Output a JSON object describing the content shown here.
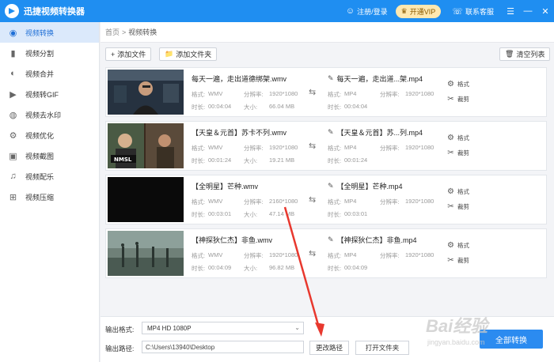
{
  "app": {
    "title": "迅捷视频转换器",
    "login": "注册/登录",
    "vip": "开通VIP",
    "service": "联系客服"
  },
  "sidebar": {
    "items": [
      {
        "label": "视频转换",
        "icon": "video-convert-icon"
      },
      {
        "label": "视频分割",
        "icon": "split-icon"
      },
      {
        "label": "视频合并",
        "icon": "merge-icon"
      },
      {
        "label": "视频转GIF",
        "icon": "gif-icon"
      },
      {
        "label": "视频去水印",
        "icon": "watermark-remove-icon"
      },
      {
        "label": "视频优化",
        "icon": "optimize-icon"
      },
      {
        "label": "视频截图",
        "icon": "screenshot-icon"
      },
      {
        "label": "视频配乐",
        "icon": "music-icon"
      },
      {
        "label": "视频压缩",
        "icon": "compress-icon"
      }
    ]
  },
  "breadcrumb": {
    "home": "首页",
    "sep": ">",
    "current": "视频转换"
  },
  "toolbar": {
    "add_file": "添加文件",
    "add_folder": "添加文件夹",
    "clear_list": "清空列表"
  },
  "labels": {
    "format": "格式:",
    "resolution": "分辨率:",
    "duration": "时长:",
    "size": "大小:",
    "act_format": "格式",
    "act_cut": "裁剪"
  },
  "files": [
    {
      "src_name": "每天一遍，走出道德绑架.wmv",
      "src_format": "WMV",
      "src_resolution": "1920*1080",
      "src_duration": "00:04:04",
      "src_size": "66.04 MB",
      "dst_name": "每天一遍，走出道...架.mp4",
      "dst_format": "MP4",
      "dst_resolution": "1920*1080",
      "dst_duration": "00:04:04"
    },
    {
      "src_name": "【天皇＆元首】苏卡不列.wmv",
      "src_format": "WMV",
      "src_resolution": "1920*1080",
      "src_duration": "00:01:24",
      "src_size": "19.21 MB",
      "dst_name": "【天皇＆元首】苏...列.mp4",
      "dst_format": "MP4",
      "dst_resolution": "1920*1080",
      "dst_duration": "00:01:24"
    },
    {
      "src_name": "【全明星】芒种.wmv",
      "src_format": "WMV",
      "src_resolution": "2160*1080",
      "src_duration": "00:03:01",
      "src_size": "47.14 MB",
      "dst_name": "【全明星】芒种.mp4",
      "dst_format": "MP4",
      "dst_resolution": "1920*1080",
      "dst_duration": "00:03:01"
    },
    {
      "src_name": "【神探狄仁杰】非鱼.wmv",
      "src_format": "WMV",
      "src_resolution": "1920*1080",
      "src_duration": "00:04:09",
      "src_size": "96.82 MB",
      "dst_name": "【神探狄仁杰】非鱼.mp4",
      "dst_format": "MP4",
      "dst_resolution": "1920*1080",
      "dst_duration": "00:04:09"
    }
  ],
  "bottom": {
    "output_format_label": "输出格式:",
    "output_format_value": "MP4  HD 1080P",
    "output_path_label": "输出路径:",
    "output_path_value": "C:\\Users\\13940\\Desktop",
    "change_path": "更改路径",
    "open_folder": "打开文件夹",
    "convert_all": "全部转换"
  },
  "watermark": {
    "text": "Bai经验",
    "sub": "jingyan.baidu.com"
  },
  "colors": {
    "accent": "#1f8ef1",
    "annotation_arrow": "#e8382e"
  }
}
